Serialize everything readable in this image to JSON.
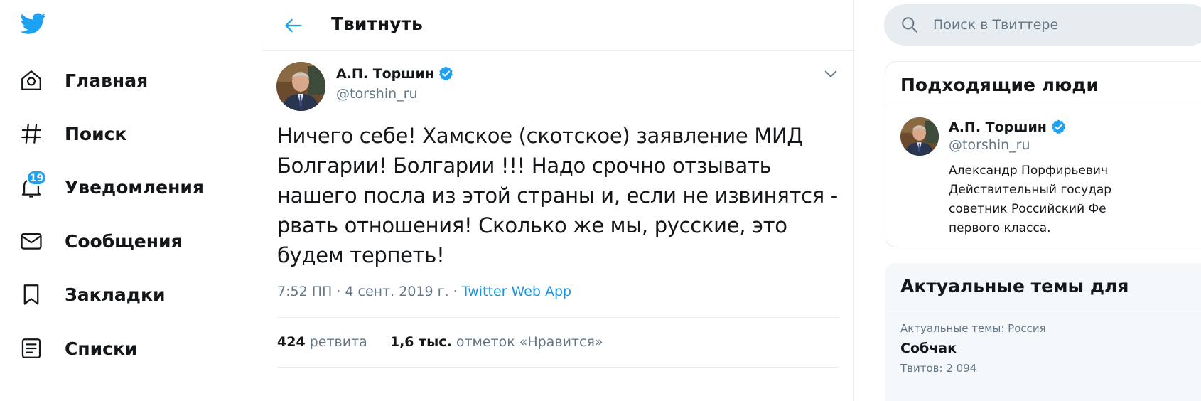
{
  "colors": {
    "accent": "#1da1f2",
    "text": "#14171a",
    "secondary": "#657786",
    "border": "#e6ecf0"
  },
  "nav": {
    "logo_icon": "twitter-bird-icon",
    "items": [
      {
        "label": "Главная",
        "icon": "home-icon"
      },
      {
        "label": "Поиск",
        "icon": "hashtag-icon"
      },
      {
        "label": "Уведомления",
        "icon": "bell-icon",
        "badge": "19"
      },
      {
        "label": "Сообщения",
        "icon": "envelope-icon"
      },
      {
        "label": "Закладки",
        "icon": "bookmark-icon"
      },
      {
        "label": "Списки",
        "icon": "list-icon"
      }
    ]
  },
  "header": {
    "title": "Твитнуть"
  },
  "tweet": {
    "author_name": "А.П. Торшин",
    "author_handle": "@torshin_ru",
    "verified": true,
    "text": "Ничего себе! Хамское (скотское) заявление МИД Болгарии! Болгарии !!! Надо срочно отзывать нашего посла из этой страны и, если не извинятся - рвать отношения! Сколько же мы, русские, это будем терпеть!",
    "timestamp": "7:52 ПП · 4 сент. 2019 г. · ",
    "source": "Twitter Web App",
    "retweets_count": "424",
    "retweets_label": "ретвита",
    "likes_count": "1,6 тыс.",
    "likes_label": "отметок «Нравится»"
  },
  "search": {
    "placeholder": "Поиск в Твиттере"
  },
  "people": {
    "title": "Подходящие люди",
    "person": {
      "name": "А.П. Торшин",
      "handle": "@torshin_ru",
      "bio_lines": [
        "Александр Порфирьевич",
        "Действительный государ",
        "советник Российский Фе",
        "первого класса."
      ]
    }
  },
  "trends": {
    "title": "Актуальные темы для",
    "items": [
      {
        "context": "Актуальные темы: Россия",
        "name": "Собчак",
        "count": "Твитов: 2 094"
      }
    ]
  }
}
